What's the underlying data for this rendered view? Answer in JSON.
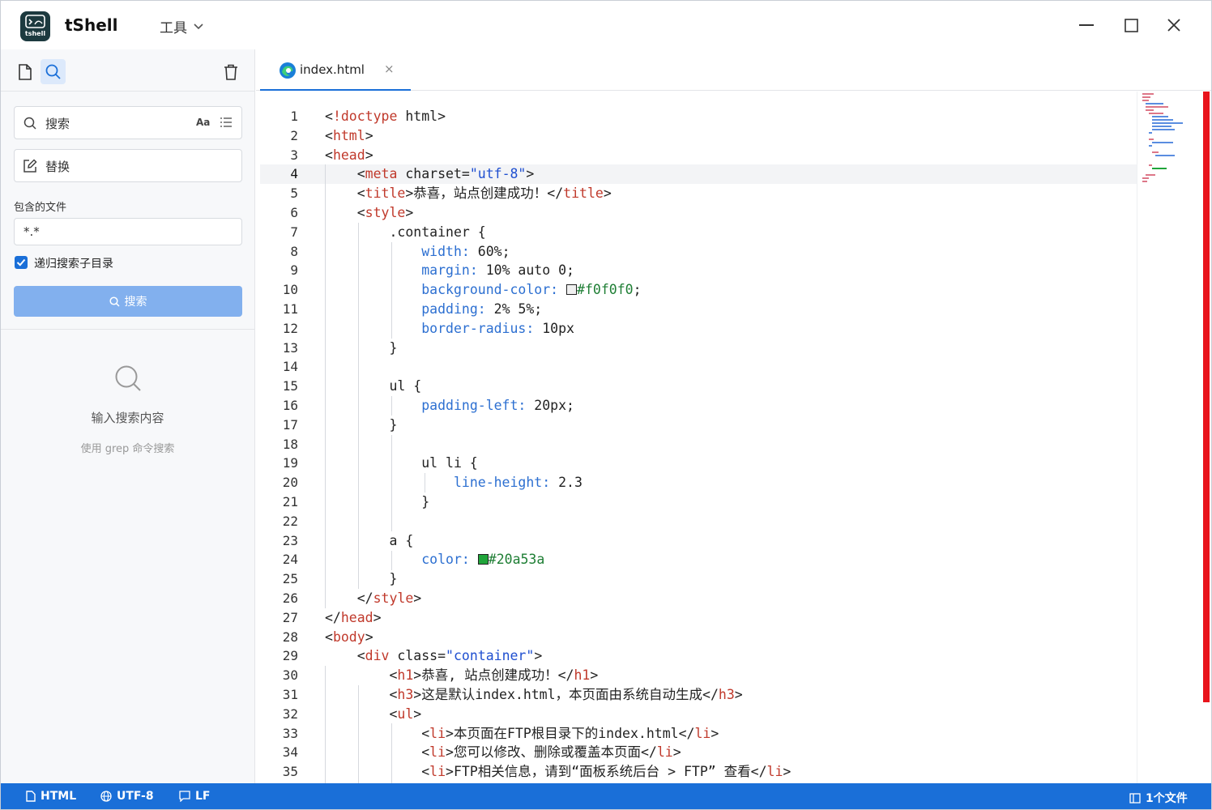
{
  "app": {
    "name": "tShell",
    "logo_text": "tshell"
  },
  "menu": {
    "tools_label": "工具"
  },
  "sidebar": {
    "search_placeholder": "搜索",
    "match_case_label": "Aa",
    "replace_placeholder": "替换",
    "include_files_label": "包含的文件",
    "include_files_value": "*.*",
    "recursive_label": "递归搜索子目录",
    "recursive_checked": true,
    "search_button_label": "搜索",
    "empty_title": "输入搜索内容",
    "empty_subtitle": "使用 grep 命令搜索"
  },
  "tab": {
    "filename": "index.html",
    "close_glyph": "×"
  },
  "editor": {
    "current_line": 4,
    "lines": [
      {
        "n": "1",
        "text": "<!doctype html>"
      },
      {
        "n": "2",
        "text": "<html>"
      },
      {
        "n": "3",
        "text": "<head>"
      },
      {
        "n": "4",
        "text": "    <meta charset=\"utf-8\">"
      },
      {
        "n": "5",
        "text": "    <title>恭喜，站点创建成功！</title>"
      },
      {
        "n": "6",
        "text": "    <style>"
      },
      {
        "n": "7",
        "text": "        .container {"
      },
      {
        "n": "8",
        "text": "            width: 60%;"
      },
      {
        "n": "9",
        "text": "            margin: 10% auto 0;"
      },
      {
        "n": "10",
        "text": "            background-color:  #f0f0f0;"
      },
      {
        "n": "11",
        "text": "            padding: 2% 5%;"
      },
      {
        "n": "12",
        "text": "            border-radius: 10px"
      },
      {
        "n": "13",
        "text": "        }"
      },
      {
        "n": "14",
        "text": ""
      },
      {
        "n": "15",
        "text": "        ul {"
      },
      {
        "n": "16",
        "text": "            padding-left: 20px;"
      },
      {
        "n": "17",
        "text": "        }"
      },
      {
        "n": "18",
        "text": ""
      },
      {
        "n": "19",
        "text": "            ul li {"
      },
      {
        "n": "20",
        "text": "                line-height: 2.3"
      },
      {
        "n": "21",
        "text": "            }"
      },
      {
        "n": "22",
        "text": ""
      },
      {
        "n": "23",
        "text": "        a {"
      },
      {
        "n": "24",
        "text": "            color:  #20a53a"
      },
      {
        "n": "25",
        "text": "        }"
      },
      {
        "n": "26",
        "text": "    </style>"
      },
      {
        "n": "27",
        "text": "</head>"
      },
      {
        "n": "28",
        "text": "<body>"
      },
      {
        "n": "29",
        "text": "    <div class=\"container\">"
      },
      {
        "n": "30",
        "text": "        <h1>恭喜, 站点创建成功！</h1>"
      },
      {
        "n": "31",
        "text": "        <h3>这是默认index.html，本页面由系统自动生成</h3>"
      },
      {
        "n": "32",
        "text": "        <ul>"
      },
      {
        "n": "33",
        "text": "            <li>本页面在FTP根目录下的index.html</li>"
      },
      {
        "n": "34",
        "text": "            <li>您可以修改、删除或覆盖本页面</li>"
      },
      {
        "n": "35",
        "text": "            <li>FTP相关信息，请到“面板系统后台 > FTP” 查看</li>"
      }
    ],
    "swatches": [
      {
        "line": 10,
        "color": "#f0f0f0"
      },
      {
        "line": 24,
        "color": "#20a53a"
      }
    ]
  },
  "colors": {
    "accent": "#1a6fd8",
    "scroll_marker": "#e8141c",
    "tag": "#c0392b",
    "attr": "#b03060",
    "string": "#1f4fd0",
    "property": "#2c6fd1",
    "value": "#1e7e34"
  },
  "statusbar": {
    "language": "HTML",
    "encoding": "UTF-8",
    "line_ending": "LF",
    "file_count": "1个文件"
  }
}
